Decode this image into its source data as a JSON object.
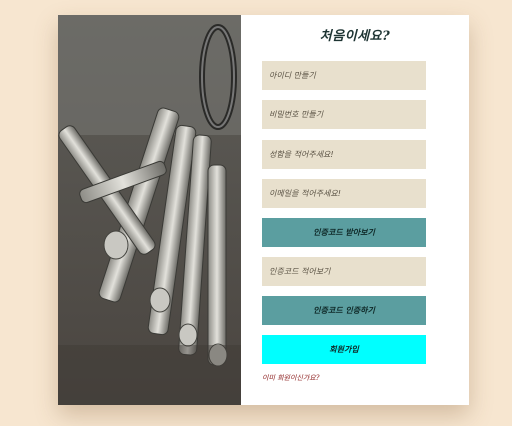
{
  "form": {
    "title": "처음이세요?",
    "id_field": "아이디 만들기",
    "password_field": "비밀번호 만들기",
    "name_field": "성함을 적어주세요!",
    "email_field": "이메일을 적어주세요!",
    "send_code_button": "인증코드 받아보기",
    "code_field": "인증코드 적어보기",
    "verify_button": "인증코드 인증하기",
    "signup_button": "회원가입",
    "login_link": "이미 회원이신가요?"
  },
  "colors": {
    "page_background": "#f7e6d0",
    "field_background": "#e8e0cd",
    "teal_button": "#5b9ea0",
    "signup_button": "#00ffff",
    "link": "#8a1a1a"
  },
  "image": {
    "subject": "keys-photo"
  }
}
